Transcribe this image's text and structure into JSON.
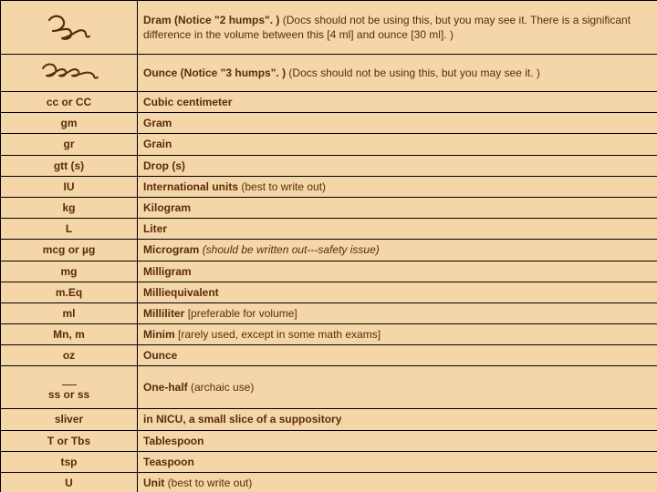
{
  "rows": [
    {
      "kind": "glyph",
      "glyph": "dram",
      "meaning_bold": "Dram (Notice \"2 humps\". ) ",
      "meaning_plain": "(Docs should not be using this, but you may see it. There is a significant difference in the volume between this [4 ml] and ounce [30 ml]. )"
    },
    {
      "kind": "glyph",
      "glyph": "ounce",
      "meaning_bold": "Ounce (Notice \"3 humps\". ) ",
      "meaning_plain": "(Docs should not be using this, but you may see it. )"
    },
    {
      "abbrev": "cc or CC",
      "meaning_bold": "Cubic centimeter",
      "meaning_plain": ""
    },
    {
      "abbrev": "gm",
      "meaning_bold": "Gram",
      "meaning_plain": ""
    },
    {
      "abbrev": "gr",
      "meaning_bold": "Grain",
      "meaning_plain": ""
    },
    {
      "abbrev": "gtt (s)",
      "meaning_bold": "Drop (s)",
      "meaning_plain": ""
    },
    {
      "abbrev": "IU",
      "meaning_bold": "International units ",
      "meaning_plain": "(best to write out)"
    },
    {
      "abbrev": "kg",
      "meaning_bold": "Kilogram",
      "meaning_plain": ""
    },
    {
      "abbrev": "L",
      "meaning_bold": "Liter",
      "meaning_plain": ""
    },
    {
      "abbrev": "mcg or µg",
      "meaning_bold": "Microgram ",
      "meaning_plain_italic": "(should be written out---safety issue)"
    },
    {
      "abbrev": "mg",
      "meaning_bold": "Milligram",
      "meaning_plain": ""
    },
    {
      "abbrev": "m.Eq",
      "meaning_bold": "Milliequivalent",
      "meaning_plain": ""
    },
    {
      "abbrev": "ml",
      "meaning_bold": "Milliliter ",
      "meaning_plain": "[preferable for volume]"
    },
    {
      "abbrev": "Mn, m",
      "meaning_bold": "Minim ",
      "meaning_plain": "[rarely used, except in some math exams]"
    },
    {
      "abbrev": "oz",
      "meaning_bold": "Ounce",
      "meaning_plain": ""
    },
    {
      "kind": "ss",
      "abbrev_line2": "ss  or ss",
      "meaning_bold": "One-half ",
      "meaning_plain": "(archaic use)"
    },
    {
      "abbrev": "sliver",
      "meaning_bold": "in NICU, a small slice of a suppository",
      "meaning_plain": ""
    },
    {
      "abbrev": "T or Tbs",
      "meaning_bold": "Tablespoon",
      "meaning_plain": ""
    },
    {
      "abbrev": "tsp",
      "meaning_bold": "Teaspoon",
      "meaning_plain": ""
    },
    {
      "abbrev": "U",
      "meaning_bold": "Unit ",
      "meaning_plain": "(best to write out)"
    }
  ]
}
